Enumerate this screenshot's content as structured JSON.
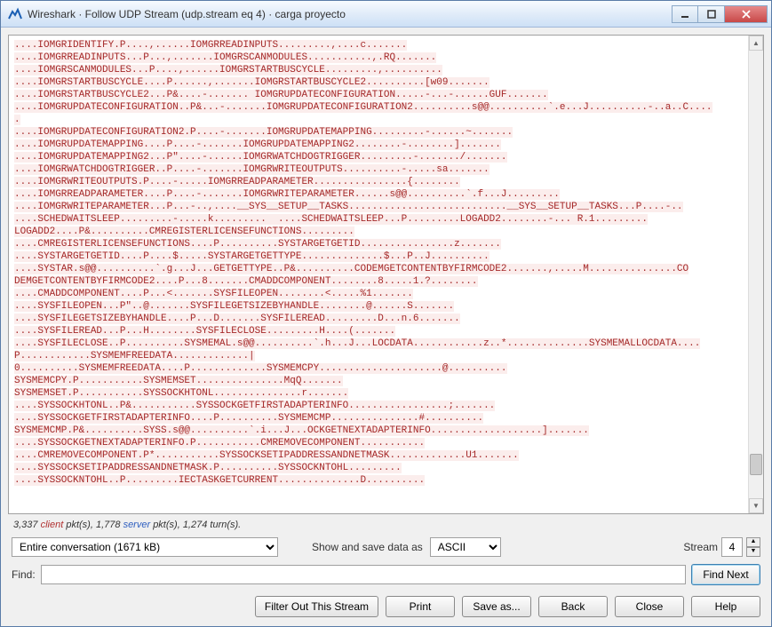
{
  "window": {
    "title": "Wireshark · Follow UDP Stream (udp.stream eq 4) · carga proyecto"
  },
  "stream": {
    "content": "....IOMGRIDENTIFY.P....,......IOMGRREADINPUTS.........,....c.......\n....IOMGRREADINPUTS...P...,.......IOMGRSCANMODULES...........,.RQ.......\n....IOMGRSCANMODULES...P....,......IOMGRSTARTBUSCYCLE.........,..........\n....IOMGRSTARTBUSCYCLE....P......,.......IOMGRSTARTBUSCYCLE2..........[w09.......\n....IOMGRSTARTBUSCYCLE2...P&....-....... IOMGRUPDATECONFIGURATION.....-...-......GUF.......\n....IOMGRUPDATECONFIGURATION..P&...-.......IOMGRUPDATECONFIGURATION2..........s@@..........`.e...J..........-..a..C....\n.\n....IOMGRUPDATECONFIGURATION2.P....-.......IOMGRUPDATEMAPPING.........-......~.......\n....IOMGRUPDATEMAPPING....P....-.......IOMGRUPDATEMAPPING2........-........].......\n....IOMGRUPDATEMAPPING2...P\"....-......IOMGRWATCHDOGTRIGGER.........-......./.......\n....IOMGRWATCHDOGTRIGGER..P....-.......IOMGRWRITEOUTPUTS..........-.....sa.......\n....IOMGRWRITEOUTPUTS.P....-.....IOMGRREADPARAMETER................{........\n....IOMGRREADPARAMETER....P....-.......IOMGRWRITEPARAMETER......s@@..........`.f...J.........\n....IOMGRWRITEPARAMETER...P...-..,....__SYS__SETUP__TASKS...........................__SYS__SETUP__TASKS...P....-..\n....SCHEDWAITSLEEP.........-.....k.........  ....SCHEDWAITSLEEP...P.........LOGADD2........-... R.1.........\nLOGADD2....P&..........CMREGISTERLICENSEFUNCTIONS.........\n....CMREGISTERLICENSEFUNCTIONS....P..........SYSTARGETGETID................z.......\n....SYSTARGETGETID....P....$.....SYSTARGETGETTYPE..............$...P..J..........\n....SYSTAR.s@@..........`.g...J...GETGETTYPE..P&..........CODEMGETCONTENTBYFIRMCODE2.......,.....M...............CO\nDEMGETCONTENTBYFIRMCODE2....P...8.......CMADDCOMPONENT........8.....1.?........\n....CMADDCOMPONENT....P...<.......SYSFILEOPEN........<.....%1.......\n....SYSFILEOPEN...P\"..@.......SYSFILEGETSIZEBYHANDLE........@......S.......\n....SYSFILEGETSIZEBYHANDLE....P...D.......SYSFILEREAD.........D...n.6.......\n....SYSFILEREAD...P...H........SYSFILECLOSE.........H....(.......\n....SYSFILECLOSE..P..........SYSMEMAL.s@@..........`.h...J...LOCDATA............z..*..............SYSMEMALLOCDATA....\nP............SYSMEMFREEDATA.............|\n0..........SYSMEMFREEDATA....P.............SYSMEMCPY.....................@..........\nSYSMEMCPY.P...........SYSMEMSET...............MqQ.......\nSYSMEMSET.P...........SYSSOCKHTONL...............r.......\n....SYSSOCKHTONL..P&...........SYSSOCKGETFIRSTADAPTERINFO.................;.......\n....SYSSOCKGETFIRSTADAPTERINFO....P..........SYSMEMCMP...............#..........\nSYSMEMCMP.P&..........SYSS.s@@..........`.i...J...OCKGETNEXTADAPTERINFO...................].......\n....SYSSOCKGETNEXTADAPTERINFO.P...........CMREMOVECOMPONENT...........\n....CMREMOVECOMPONENT.P*...........SYSSOCKSETIPADDRESSANDNETMASK.............U1.......\n....SYSSOCKSETIPADDRESSANDNETMASK.P..........SYSSOCKNTOHL.........\n....SYSSOCKNTOHL..P.........IECTASKGETCURRENT..............D.........."
  },
  "info": {
    "client_pkts": "3,337",
    "client_label": "client",
    "pkts": "pkt(s),",
    "server_pkts": "1,778",
    "server_label": "server",
    "turns": "1,274 turn(s)."
  },
  "controls": {
    "conversation": "Entire conversation (1671 kB)",
    "show_save_label": "Show and save data as",
    "ascii": "ASCII",
    "stream_label": "Stream",
    "stream_value": "4"
  },
  "find": {
    "label": "Find:",
    "value": "",
    "find_next": "Find Next"
  },
  "buttons": {
    "filter": "Filter Out This Stream",
    "print": "Print",
    "saveas": "Save as...",
    "back": "Back",
    "close": "Close",
    "help": "Help"
  }
}
